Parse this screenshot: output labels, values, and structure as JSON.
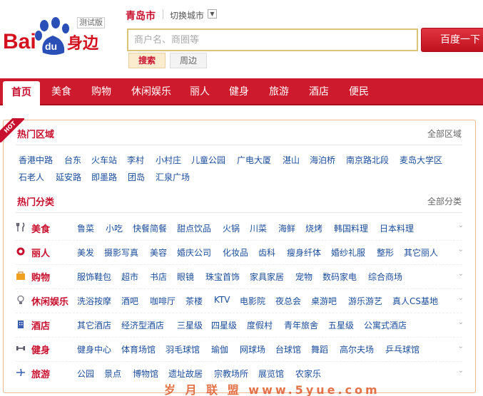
{
  "logo": {
    "text_bai": "Bai",
    "text_du": "du",
    "text_suffix": "身边",
    "badge": "测试版"
  },
  "header": {
    "city": "青岛市",
    "switch_city": "切换城市"
  },
  "search": {
    "placeholder": "商户名、商圈等",
    "button": "百度一下",
    "tab_search": "搜索",
    "tab_nearby": "周边"
  },
  "nav": {
    "items": [
      "首页",
      "美食",
      "购物",
      "休闲娱乐",
      "丽人",
      "健身",
      "旅游",
      "酒店",
      "便民"
    ],
    "active": "首页"
  },
  "ribbon": "HOT",
  "hot_areas": {
    "title": "热门区域",
    "more": "全部区域",
    "row1": [
      "香港中路",
      "台东",
      "火车站",
      "李村",
      "小村庄",
      "儿童公园",
      "广电大厦",
      "湛山",
      "海泊桥",
      "南京路北段",
      "麦岛大学区"
    ],
    "row2": [
      "石老人",
      "延安路",
      "即墨路",
      "团岛",
      "汇泉广场"
    ]
  },
  "hot_categories": {
    "title": "热门分类",
    "more": "全部分类",
    "rows": [
      {
        "name": "美食",
        "icon": "fork-knife-icon",
        "items": [
          "鲁菜",
          "小吃",
          "快餐简餐",
          "甜点饮品",
          "火锅",
          "川菜",
          "海鲜",
          "烧烤",
          "韩国料理",
          "日本料理"
        ]
      },
      {
        "name": "丽人",
        "icon": "beauty-icon",
        "items": [
          "美发",
          "摄影写真",
          "美容",
          "婚庆公司",
          "化妆品",
          "齿科",
          "瘦身纤体",
          "婚纱礼服",
          "整形",
          "其它丽人"
        ]
      },
      {
        "name": "购物",
        "icon": "shopping-bag-icon",
        "items": [
          "服饰鞋包",
          "超市",
          "书店",
          "眼镜",
          "珠宝首饰",
          "家具家居",
          "宠物",
          "数码家电",
          "综合商场"
        ]
      },
      {
        "name": "休闲娱乐",
        "icon": "bulb-icon",
        "items": [
          "洗浴按摩",
          "酒吧",
          "咖啡厅",
          "茶楼",
          "KTV",
          "电影院",
          "夜总会",
          "桌游吧",
          "游乐游艺",
          "真人CS基地"
        ]
      },
      {
        "name": "酒店",
        "icon": "building-icon",
        "items": [
          "其它酒店",
          "经济型酒店",
          "三星级",
          "四星级",
          "度假村",
          "青年旅舍",
          "五星级",
          "公寓式酒店"
        ]
      },
      {
        "name": "健身",
        "icon": "dumbbell-icon",
        "items": [
          "健身中心",
          "体育场馆",
          "羽毛球馆",
          "瑜伽",
          "网球场",
          "台球馆",
          "舞蹈",
          "高尔夫场",
          "乒乓球馆"
        ]
      },
      {
        "name": "旅游",
        "icon": "plane-icon",
        "items": [
          "公园",
          "景点",
          "博物馆",
          "遗址故居",
          "宗教场所",
          "展览馆",
          "农家乐"
        ]
      }
    ]
  },
  "watermark": "岁 月 联 盟  www.5yue.com"
}
